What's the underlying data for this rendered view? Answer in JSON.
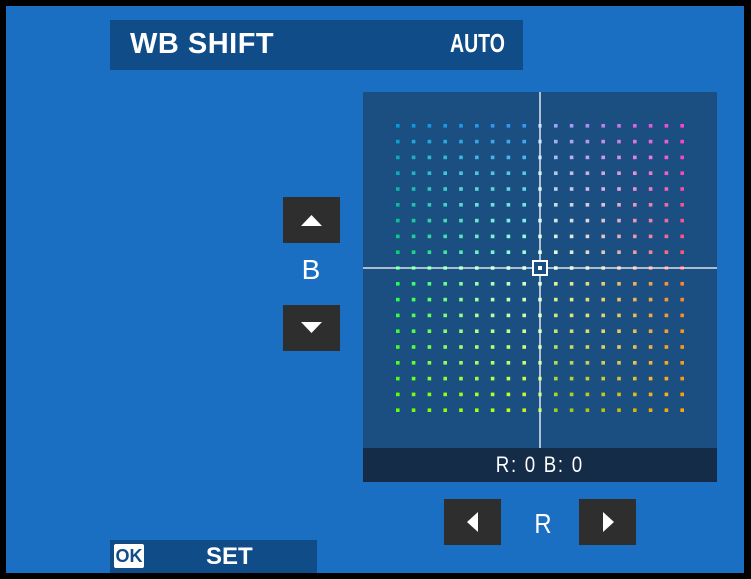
{
  "header": {
    "title": "WB SHIFT",
    "wb_mode": "AUTO"
  },
  "controls": {
    "b_label": "B",
    "r_label": "R",
    "readout": "R: 0 B: 0",
    "r_value": 0,
    "b_value": 0
  },
  "footer": {
    "ok_label": "OK",
    "set_label": "SET"
  },
  "icons": {
    "up": "up-arrow-icon",
    "down": "down-arrow-icon",
    "left": "left-arrow-icon",
    "right": "right-arrow-icon",
    "ok": "ok-button-icon"
  },
  "colors": {
    "screen_bg": "#1a6fc3",
    "title_bar": "#0f4c88",
    "grid_bg": "#1b4f82",
    "readout_bg": "#142c48",
    "button_bg": "#2e2e2e"
  }
}
